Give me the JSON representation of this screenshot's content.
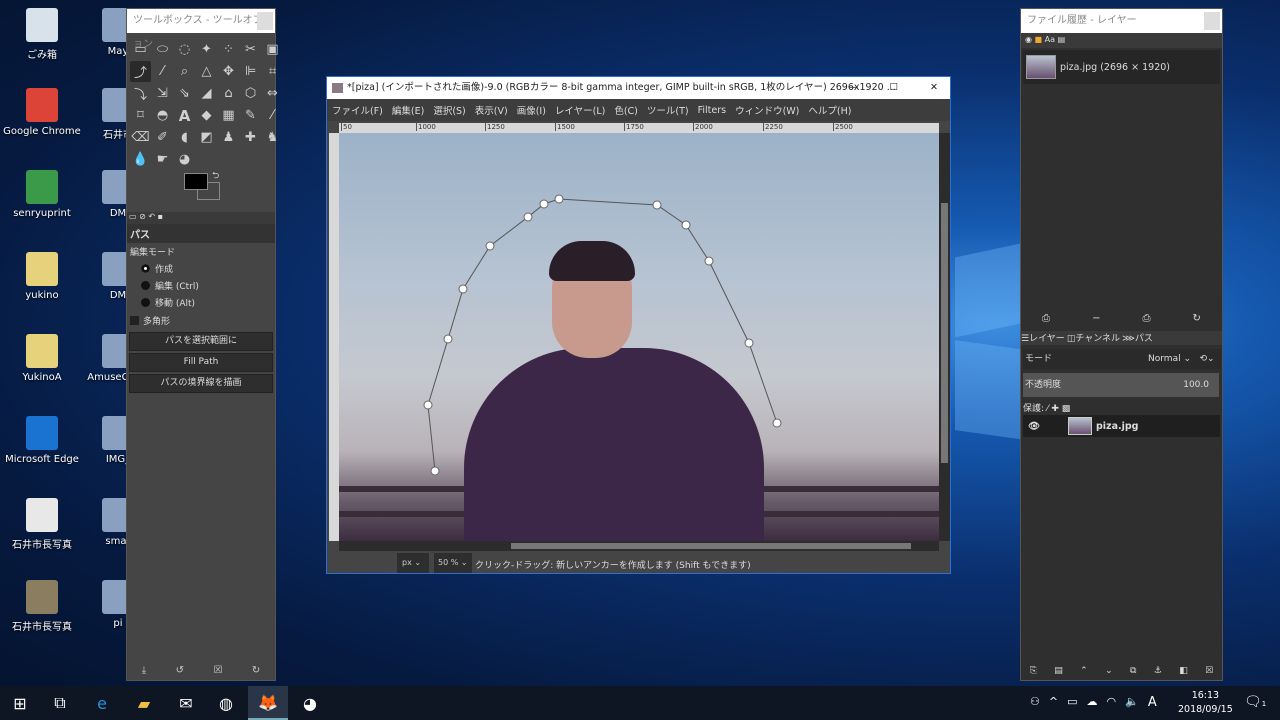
{
  "desktop": {
    "icons": [
      {
        "label": "ごみ箱",
        "color": "#d8e2ea"
      },
      {
        "label": "Google Chrome",
        "color": "#db4437"
      },
      {
        "label": "senryuprint",
        "color": "#3a9a4a"
      },
      {
        "label": "yukino",
        "color": "#e6d27a"
      },
      {
        "label": "YukinoA",
        "color": "#e6d27a"
      },
      {
        "label": "Microsoft Edge",
        "color": "#1a73d0"
      },
      {
        "label": "石井市長写真",
        "color": "#e8e8e8"
      },
      {
        "label": "石井市長写真",
        "color": "#8a7d60"
      }
    ],
    "icons2": [
      {
        "label": "May"
      },
      {
        "label": "石井市"
      },
      {
        "label": "DM"
      },
      {
        "label": "DM"
      },
      {
        "label": "AmuseG (x6"
      },
      {
        "label": "IMG_"
      },
      {
        "label": "smar"
      },
      {
        "label": "pi"
      }
    ]
  },
  "toolbox": {
    "title": "ツールボックス - ツールオプション",
    "tool_name": "パス",
    "edit_mode_label": "編集モード",
    "modes": [
      {
        "label": "作成",
        "selected": true
      },
      {
        "label": "編集 (Ctrl)",
        "selected": false
      },
      {
        "label": "移動 (Alt)",
        "selected": false
      }
    ],
    "polygon_label": "多角形",
    "polygon_checked": false,
    "buttons": [
      "パスを選択範囲に",
      "Fill Path",
      "パスの境界線を描画"
    ],
    "fg_color": "#000000",
    "bg_color": "#ffffff"
  },
  "image_window": {
    "title": "*[piza] (インポートされた画像)-9.0 (RGBカラー 8-bit gamma integer, GIMP built-in sRGB, 1枚のレイヤー) 2696x1920 ...",
    "menu": [
      "ファイル(F)",
      "編集(E)",
      "選択(S)",
      "表示(V)",
      "画像(I)",
      "レイヤー(L)",
      "色(C)",
      "ツール(T)",
      "Filters",
      "ウィンドウ(W)",
      "ヘルプ(H)"
    ],
    "ruler_ticks": [
      "50",
      "1000",
      "1250",
      "1500",
      "1750",
      "2000",
      "2250",
      "2500"
    ],
    "unit": "px",
    "zoom": "50 %",
    "status": "クリック-ドラッグ: 新しいアンカーを作成します (Shift もできます)"
  },
  "right_dock": {
    "title": "ファイル履歴 - レイヤー",
    "history_item": "piza.jpg (2696 × 1920)",
    "tabs": [
      "レイヤー",
      "チャンネル",
      "パス"
    ],
    "mode_label": "モード",
    "mode_value": "Normal",
    "opacity_label": "不透明度",
    "opacity_value": "100.0",
    "lock_label": "保護:",
    "layer_name": "piza.jpg"
  },
  "taskbar": {
    "time": "16:13",
    "date": "2018/09/15",
    "ime": "A",
    "notifications": "1"
  }
}
